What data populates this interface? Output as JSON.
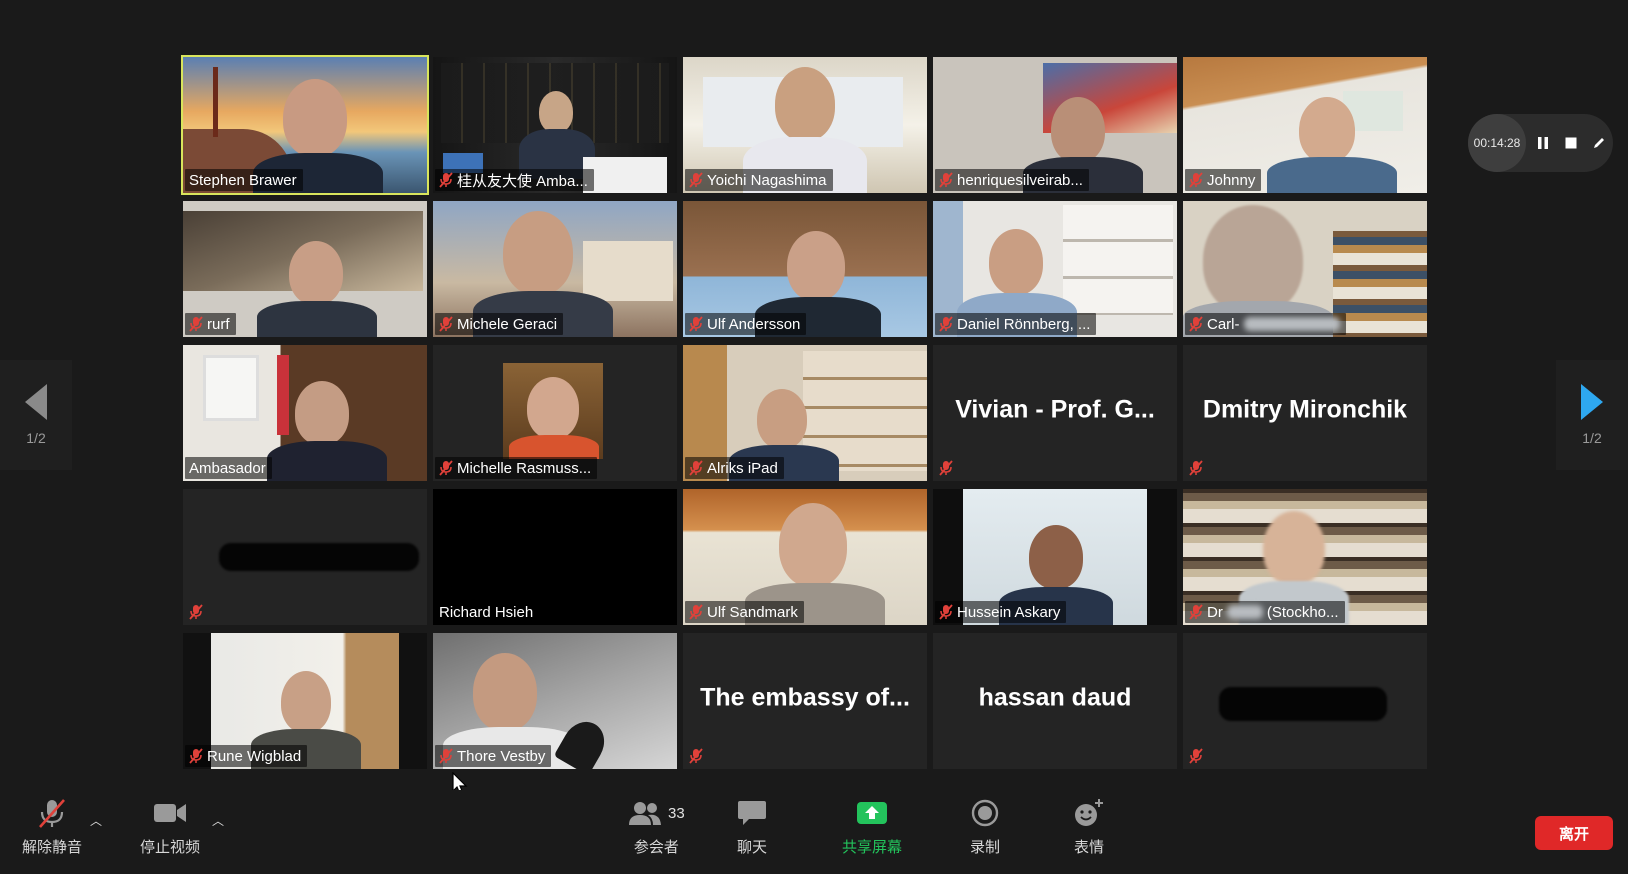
{
  "participants": [
    {
      "name": "Stephen Brawer",
      "muted": false,
      "active": true
    },
    {
      "name": "桂从友大使 Amba...",
      "muted": true
    },
    {
      "name": "Yoichi Nagashima",
      "muted": true
    },
    {
      "name": "henriquesilveirab...",
      "muted": true
    },
    {
      "name": "Johnny",
      "muted": true
    },
    {
      "name": "rurf",
      "muted": true
    },
    {
      "name": "Michele Geraci",
      "muted": true
    },
    {
      "name": "Ulf Andersson",
      "muted": true
    },
    {
      "name": "Daniel Rönnberg, ...",
      "muted": true
    },
    {
      "name": "Carl-",
      "muted": true
    },
    {
      "name": "Ambasador",
      "muted": false
    },
    {
      "name": "Michelle Rasmuss...",
      "muted": true
    },
    {
      "name": "Alriks iPad",
      "muted": true
    },
    {
      "name": "",
      "big_name": "Vivian - Prof. G...",
      "muted": true
    },
    {
      "name": "",
      "big_name": "Dmitry Mironchik",
      "muted": true
    },
    {
      "name": "",
      "muted": true
    },
    {
      "name": "Richard Hsieh",
      "muted": false
    },
    {
      "name": "Ulf Sandmark",
      "muted": true
    },
    {
      "name": "Hussein Askary",
      "muted": true
    },
    {
      "name": "Dr",
      "name_suffix": "(Stockho...",
      "muted": true
    },
    {
      "name": "Rune Wigblad",
      "muted": true
    },
    {
      "name": "Thore Vestby",
      "muted": true
    },
    {
      "name": "",
      "big_name": "The embassy of...",
      "muted": true
    },
    {
      "name": "",
      "big_name": "hassan daud",
      "muted": false
    },
    {
      "name": "",
      "muted": true
    }
  ],
  "pagination": {
    "left_page": "1/2",
    "right_page": "1/2"
  },
  "recording": {
    "timer": "00:14:28"
  },
  "toolbar": {
    "unmute_label": "解除静音",
    "stop_video_label": "停止视频",
    "participants_label": "参会者",
    "participants_count": "33",
    "chat_label": "聊天",
    "share_label": "共享屏幕",
    "record_label": "录制",
    "reactions_label": "表情",
    "leave_label": "离开"
  },
  "colors": {
    "active_speaker_border": "#d9e55c",
    "share_green": "#23c35c",
    "leave_red": "#e02828",
    "nav_blue": "#2ea8f0",
    "mute_red": "#e0413a"
  }
}
